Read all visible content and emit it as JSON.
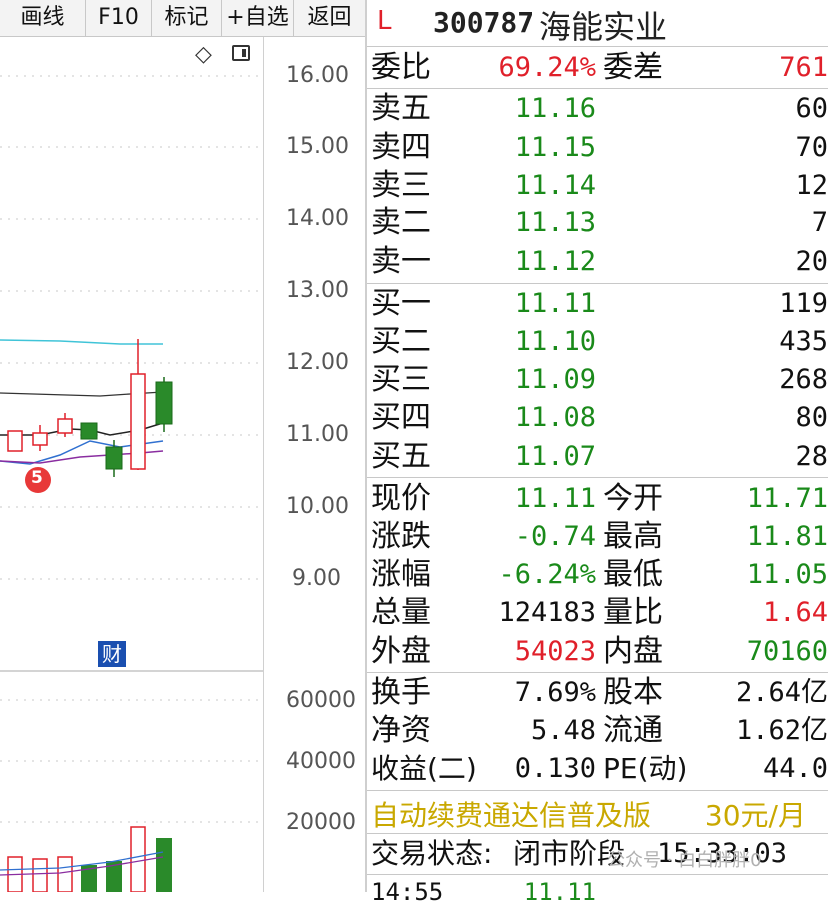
{
  "toolbar": {
    "buttons": [
      "画线",
      "F10",
      "标记",
      "+自选",
      "返回"
    ]
  },
  "chart": {
    "price_ticks": [
      "16.00",
      "15.00",
      "14.00",
      "13.00",
      "12.00",
      "11.00",
      "10.00",
      "9.00"
    ],
    "volume_ticks": [
      "60000",
      "40000",
      "20000"
    ],
    "badge_cai": "财",
    "event_marker": "5"
  },
  "chart_data": {
    "type": "candlestick",
    "price_axis": {
      "min": 9.0,
      "max": 16.0
    },
    "volume_axis": {
      "ticks": [
        60000,
        40000,
        20000
      ]
    }
  },
  "quote": {
    "flag": "L",
    "code": "300787",
    "name": "海能实业",
    "weibi_label": "委比",
    "weibi": "69.24%",
    "weicha_label": "委差",
    "weicha": "761",
    "sells": [
      {
        "label": "卖五",
        "price": "11.16",
        "vol": "60"
      },
      {
        "label": "卖四",
        "price": "11.15",
        "vol": "70"
      },
      {
        "label": "卖三",
        "price": "11.14",
        "vol": "12"
      },
      {
        "label": "卖二",
        "price": "11.13",
        "vol": "7"
      },
      {
        "label": "卖一",
        "price": "11.12",
        "vol": "20"
      }
    ],
    "buys": [
      {
        "label": "买一",
        "price": "11.11",
        "vol": "119"
      },
      {
        "label": "买二",
        "price": "11.10",
        "vol": "435"
      },
      {
        "label": "买三",
        "price": "11.09",
        "vol": "268"
      },
      {
        "label": "买四",
        "price": "11.08",
        "vol": "80"
      },
      {
        "label": "买五",
        "price": "11.07",
        "vol": "28"
      }
    ],
    "stats1": [
      {
        "l1": "现价",
        "v1": "11.11",
        "c1": "g",
        "l2": "今开",
        "v2": "11.71",
        "c2": "g"
      },
      {
        "l1": "涨跌",
        "v1": "-0.74",
        "c1": "g",
        "l2": "最高",
        "v2": "11.81",
        "c2": "g"
      },
      {
        "l1": "涨幅",
        "v1": "-6.24%",
        "c1": "g",
        "l2": "最低",
        "v2": "11.05",
        "c2": "g"
      },
      {
        "l1": "总量",
        "v1": "124183",
        "c1": "k",
        "l2": "量比",
        "v2": "1.64",
        "c2": "r"
      },
      {
        "l1": "外盘",
        "v1": "54023",
        "c1": "r",
        "l2": "内盘",
        "v2": "70160",
        "c2": "g"
      }
    ],
    "stats2": [
      {
        "l1": "换手",
        "v1": "7.69%",
        "l2": "股本",
        "v2": "2.64亿"
      },
      {
        "l1": "净资",
        "v1": "5.48",
        "l2": "流通",
        "v2": "1.62亿"
      },
      {
        "l1": "收益(二)",
        "v1": "0.130",
        "l2": "PE(动)",
        "v2": "44.0"
      }
    ],
    "promo_text": "自动续费通达信普及版",
    "promo_price": "30元/月",
    "status_label": "交易状态:",
    "status_value": "闭市阶段",
    "status_time": "15:33:03",
    "tick_time": "14:55",
    "tick_price": "11.11",
    "watermark": "公众号 · 白白胖胖0"
  },
  "colors": {
    "up": "#e0202a",
    "down": "#1a8a1a",
    "promo": "#c9a800"
  }
}
